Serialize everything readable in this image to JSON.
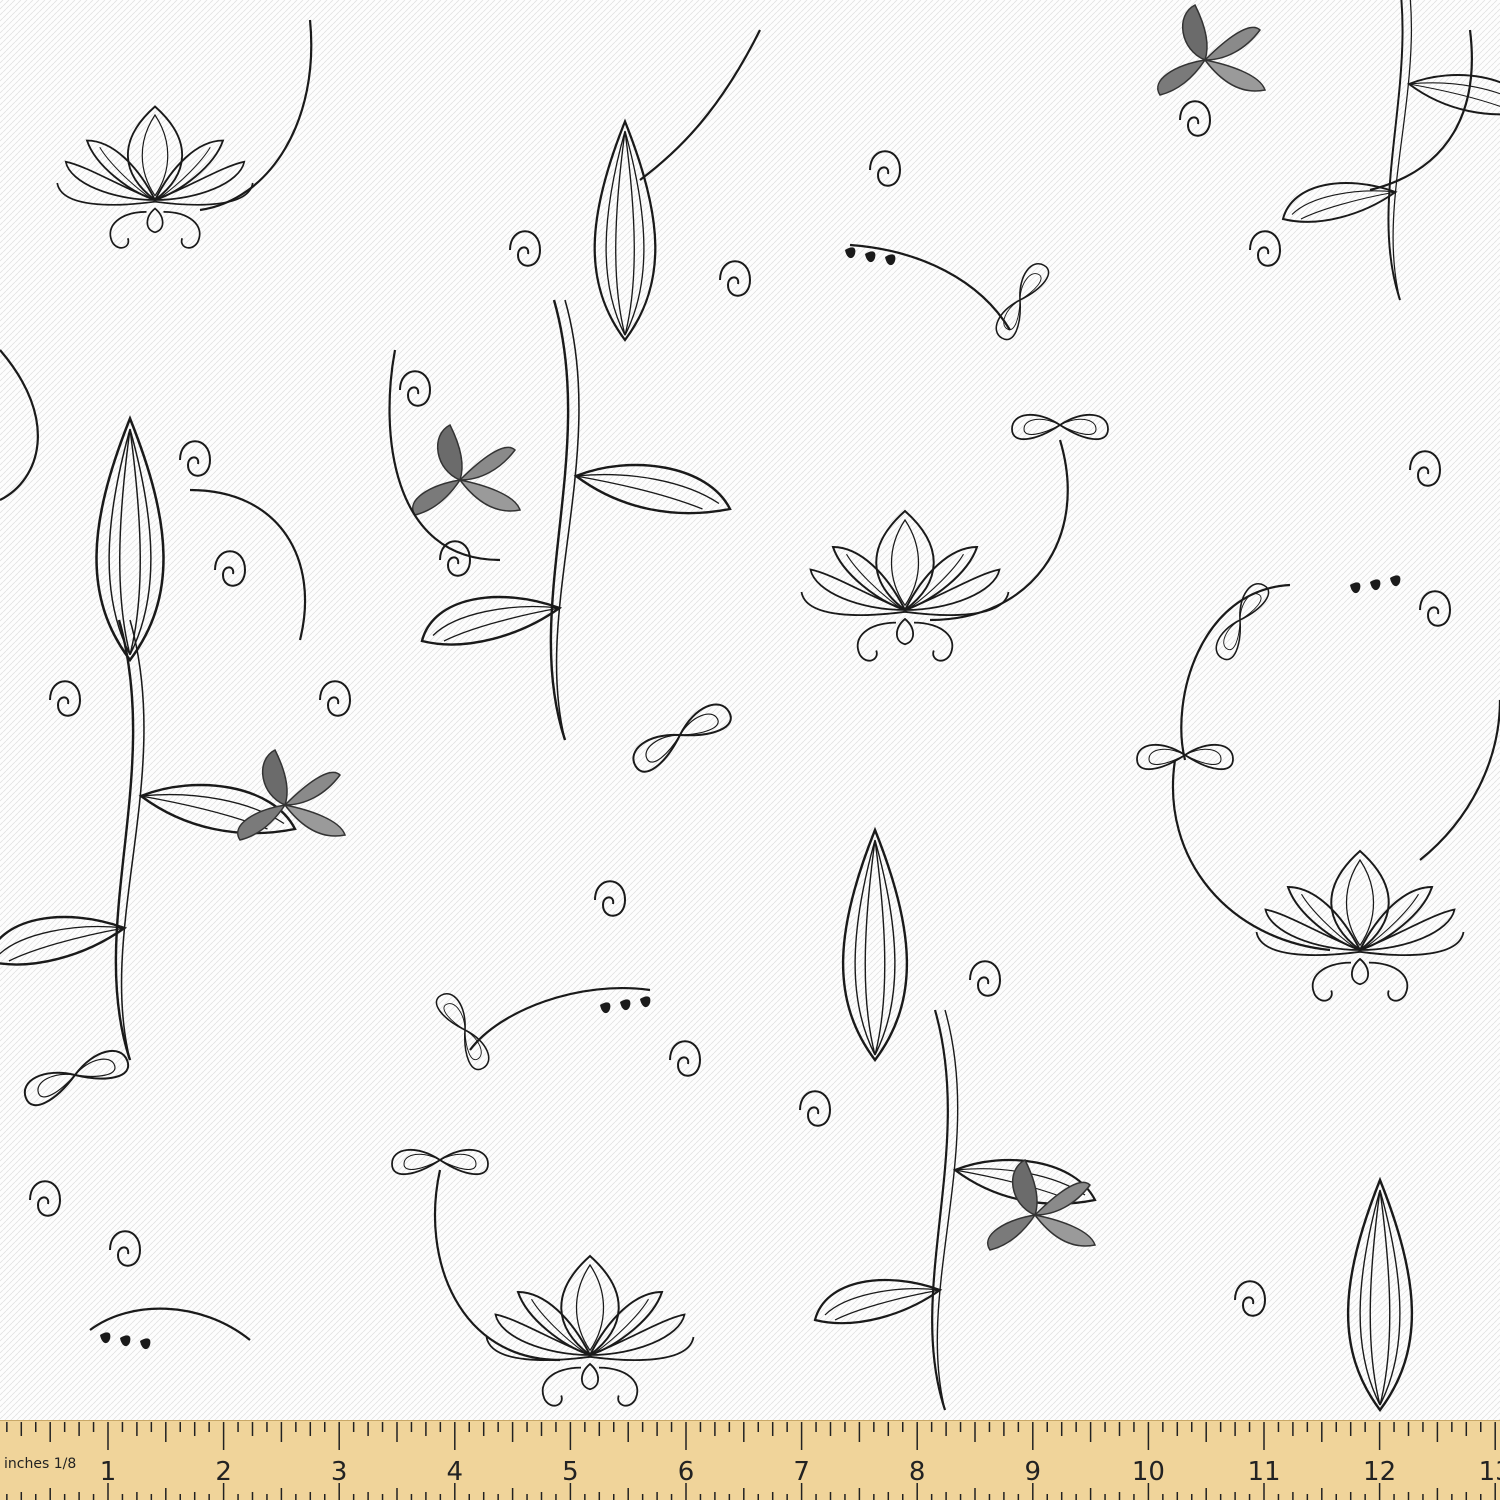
{
  "colors": {
    "background": "#fdfdfd",
    "weave": "#d8d8d8",
    "ink": "#1a1a1a",
    "flower_fill": "#6b6b6b",
    "ruler_wood": "#f0d49a",
    "ruler_edge": "#c9a867"
  },
  "pattern": {
    "description_icon": "floral-line-art-pattern",
    "motifs": [
      "lotus-flower-icon",
      "teardrop-leaf-icon",
      "swirl-vine-icon",
      "bow-leaf-icon",
      "butterfly-flower-icon"
    ]
  },
  "ruler": {
    "unit_label": "inches 1/8",
    "numbers": [
      "1",
      "2",
      "3",
      "4",
      "5",
      "6",
      "7",
      "8",
      "9",
      "10",
      "11",
      "12",
      "13"
    ]
  }
}
